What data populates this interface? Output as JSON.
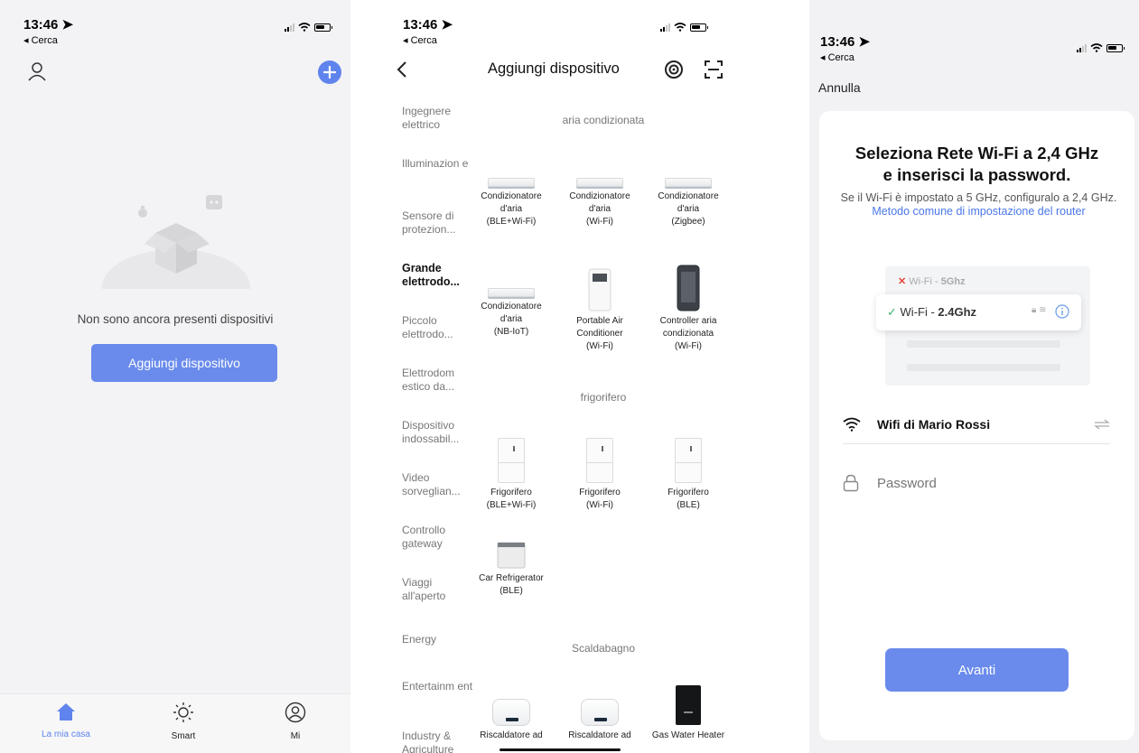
{
  "status": {
    "time": "13:46",
    "back": "◂ Cerca"
  },
  "home": {
    "empty_text": "Non sono ancora presenti dispositivi",
    "add_button": "Aggiungi dispositivo",
    "tabs": [
      {
        "label": "La mia casa",
        "icon": "home-icon"
      },
      {
        "label": "Smart",
        "icon": "sun-icon"
      },
      {
        "label": "Mi",
        "icon": "user-circle-icon"
      }
    ],
    "accent": "#5f84ed"
  },
  "add_device": {
    "title": "Aggiungi dispositivo",
    "categories": [
      "Ingegnere elettrico",
      "Illuminazion e",
      "Sensore di protezion...",
      "Grande elettrodo...",
      "Piccolo elettrodo...",
      "Elettrodom estico da...",
      "Dispositivo indossabil...",
      "Video sorveglian...",
      "Controllo gateway",
      "Viaggi all'aperto",
      "Energy",
      "Entertainm ent",
      "Industry & Agriculture"
    ],
    "selected_category": "Grande elettrodo...",
    "sections": [
      "aria condizionata",
      "frigorifero",
      "Scaldabagno"
    ],
    "ac_devices": [
      [
        "Condizionatore",
        "d'aria",
        "(BLE+Wi-Fi)"
      ],
      [
        "Condizionatore",
        "d'aria",
        "(Wi-Fi)"
      ],
      [
        "Condizionatore",
        "d'aria",
        "(Zigbee)"
      ],
      [
        "Condizionatore",
        "d'aria",
        "(NB-IoT)"
      ],
      [
        "Portable Air",
        "Conditioner",
        "(Wi-Fi)"
      ],
      [
        "Controller aria",
        "condizionata",
        "(Wi-Fi)"
      ]
    ],
    "fridge_devices": [
      [
        "Frigorifero",
        "(BLE+Wi-Fi)"
      ],
      [
        "Frigorifero",
        "(Wi-Fi)"
      ],
      [
        "Frigorifero",
        "(BLE)"
      ],
      [
        "Car Refrigerator",
        "(BLE)"
      ]
    ],
    "heater_devices": [
      [
        "Riscaldatore ad"
      ],
      [
        "Riscaldatore ad"
      ],
      [
        "Gas Water Heater"
      ]
    ]
  },
  "wifi": {
    "cancel": "Annulla",
    "title_line1": "Seleziona Rete Wi-Fi a 2,4 GHz",
    "title_line2": "e inserisci la password.",
    "desc": "Se il Wi-Fi è impostato a 5 GHz, configuralo a 2,4 GHz.",
    "desc_link": "Metodo comune di impostazione del router",
    "illu_5g_prefix": "Wi-Fi - ",
    "illu_5g": "5Ghz",
    "illu_24_prefix": "Wi-Fi - ",
    "illu_24": "2.4Ghz",
    "network_name": "Wifi di Mario Rossi",
    "password_placeholder": "Password",
    "next_button": "Avanti"
  }
}
